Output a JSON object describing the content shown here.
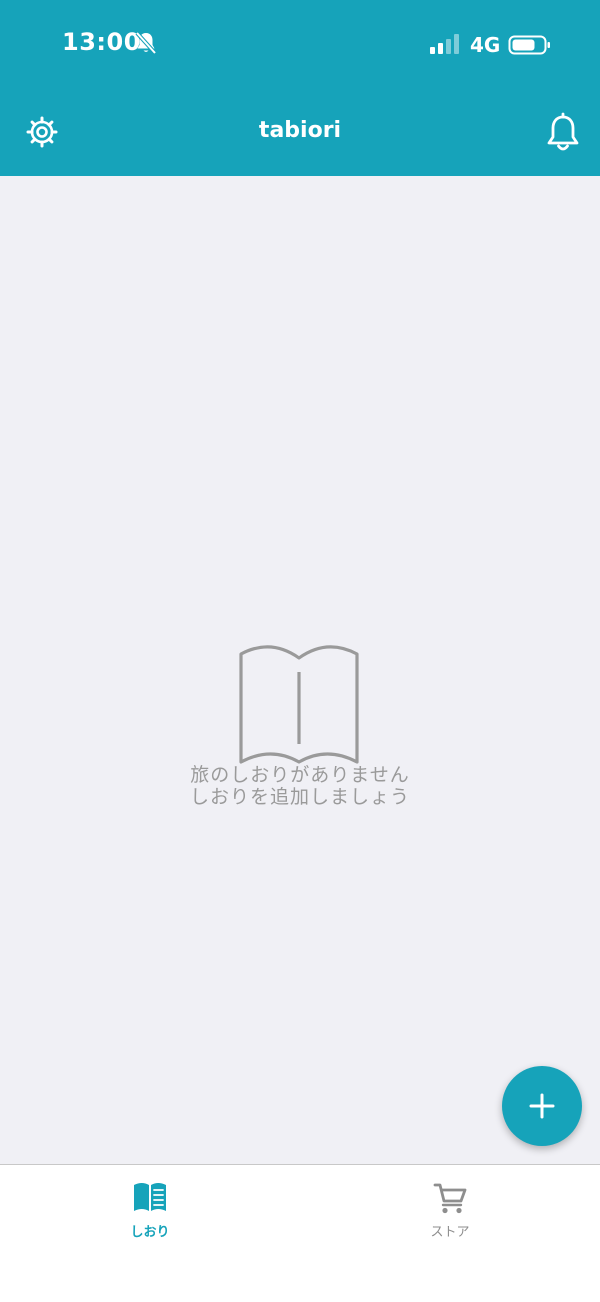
{
  "colors": {
    "accent": "#16A3BA",
    "background": "#F0F0F5",
    "muted_text": "#9A9A9A",
    "inactive_tab": "#8E8E8E"
  },
  "status_bar": {
    "time": "13:00",
    "network": "4G",
    "icons": [
      "bell-slash-icon",
      "signal-icon",
      "battery-icon"
    ]
  },
  "header": {
    "title": "tabiori",
    "left_icon": "gear-icon",
    "right_icon": "bell-icon"
  },
  "empty_state": {
    "icon": "open-book-icon",
    "line1": "旅のしおりがありません",
    "line2": "しおりを追加しましょう"
  },
  "fab": {
    "icon": "plus-icon"
  },
  "tabbar": {
    "tabs": [
      {
        "label": "しおり",
        "icon": "book-icon",
        "selected": true
      },
      {
        "label": "ストア",
        "icon": "cart-icon",
        "selected": false
      }
    ]
  }
}
